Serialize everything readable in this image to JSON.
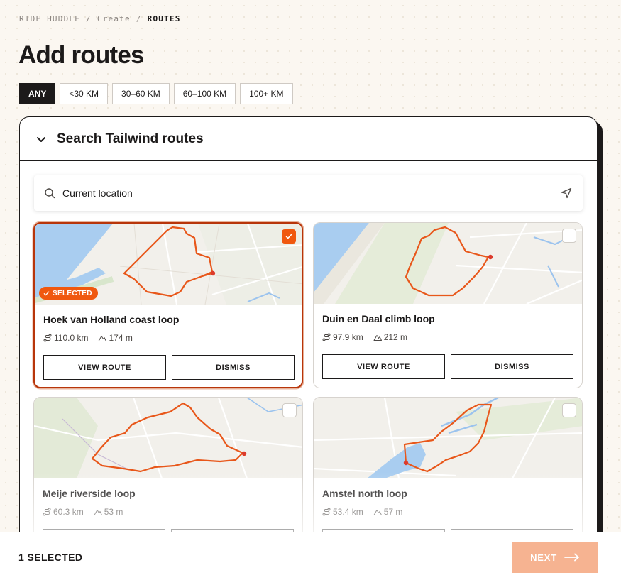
{
  "breadcrumb": [
    "RIDE HUDDLE",
    "Create",
    "ROUTES"
  ],
  "page_title": "Add routes",
  "filters": [
    {
      "label": "ANY",
      "active": true
    },
    {
      "label": "<30 KM",
      "active": false
    },
    {
      "label": "30–60 KM",
      "active": false
    },
    {
      "label": "60–100 KM",
      "active": false
    },
    {
      "label": "100+ KM",
      "active": false
    }
  ],
  "panel": {
    "title": "Search Tailwind routes",
    "expanded": true,
    "search": {
      "value": "Current location",
      "icon": "search-icon",
      "action_icon": "location-arrow-icon"
    }
  },
  "route_buttons": {
    "view": "VIEW ROUTE",
    "dismiss": "DISMISS"
  },
  "selected_badge": "SELECTED",
  "routes": [
    {
      "name": "Hoek van Holland coast loop",
      "distance": "110.0 km",
      "elevation": "174 m",
      "selected": true
    },
    {
      "name": "Duin en Daal climb loop",
      "distance": "97.9 km",
      "elevation": "212 m",
      "selected": false
    },
    {
      "name": "Meije riverside loop",
      "distance": "60.3 km",
      "elevation": "53 m",
      "selected": false
    },
    {
      "name": "Amstel north loop",
      "distance": "53.4 km",
      "elevation": "57 m",
      "selected": false
    }
  ],
  "footer": {
    "selected_count": "1 SELECTED",
    "next_label": "NEXT"
  },
  "colors": {
    "accent": "#f0580f",
    "route_line": "#e8571a",
    "water": "#a9cdf0",
    "ink": "#1c1a1a",
    "next_button": "#f6b391"
  }
}
